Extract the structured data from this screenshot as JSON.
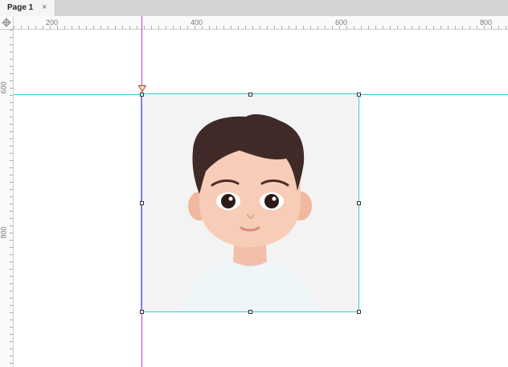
{
  "tabs": [
    {
      "label": "Page 1",
      "close": "×"
    }
  ],
  "ruler": {
    "top_labels": [
      "200",
      "400",
      "600",
      "800"
    ],
    "left_labels": [
      "600",
      "800"
    ]
  },
  "colors": {
    "vertical_guide": "#c23be0",
    "horizontal_guide": "#35c7d6",
    "selection": "#35c7d6"
  },
  "icons": {
    "corner": "crosshair-icon",
    "guide_marker": "triangle-marker-icon"
  }
}
